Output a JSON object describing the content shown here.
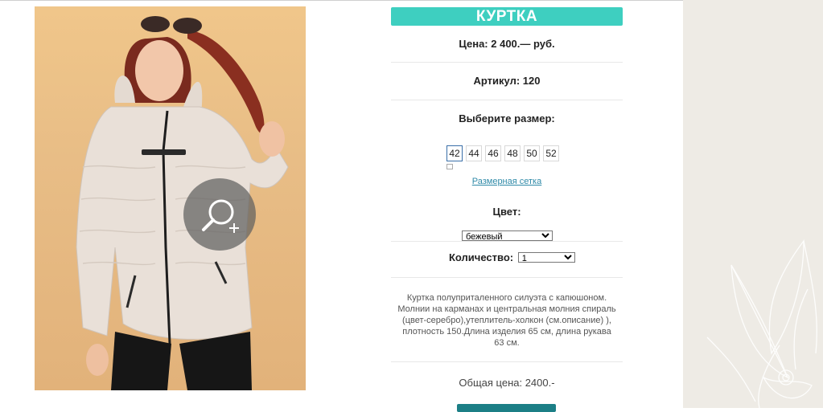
{
  "product": {
    "title": "КУРТКА",
    "price_text": "Цена: 2 400.— руб.",
    "article_text": "Артикул: 120",
    "choose_size_label": "Выберите размер:",
    "sizes": [
      "42",
      "44",
      "46",
      "48",
      "50",
      "52"
    ],
    "selected_size": "42",
    "size_chart_link": "Размерная сетка",
    "color_label": "Цвет:",
    "color_value": "бежевый",
    "quantity_label": "Количество:",
    "quantity_value": "1",
    "description": "Куртка полуприталенного силуэта с капюшоном. Молнии на карманах и центральная молния спираль (цвет-серебро),утеплитель-холкон (см.описание) ), плотность 150.Длина изделия 65 см, длина рукава 63 см.",
    "total_text": "Общая цена: 2400.-"
  },
  "colors": {
    "accent": "#3ecfc0",
    "button": "#1c7f86",
    "link": "#2f8aa8",
    "side_bg": "#eeebe5"
  },
  "icons": {
    "zoom": "zoom-in-icon"
  }
}
